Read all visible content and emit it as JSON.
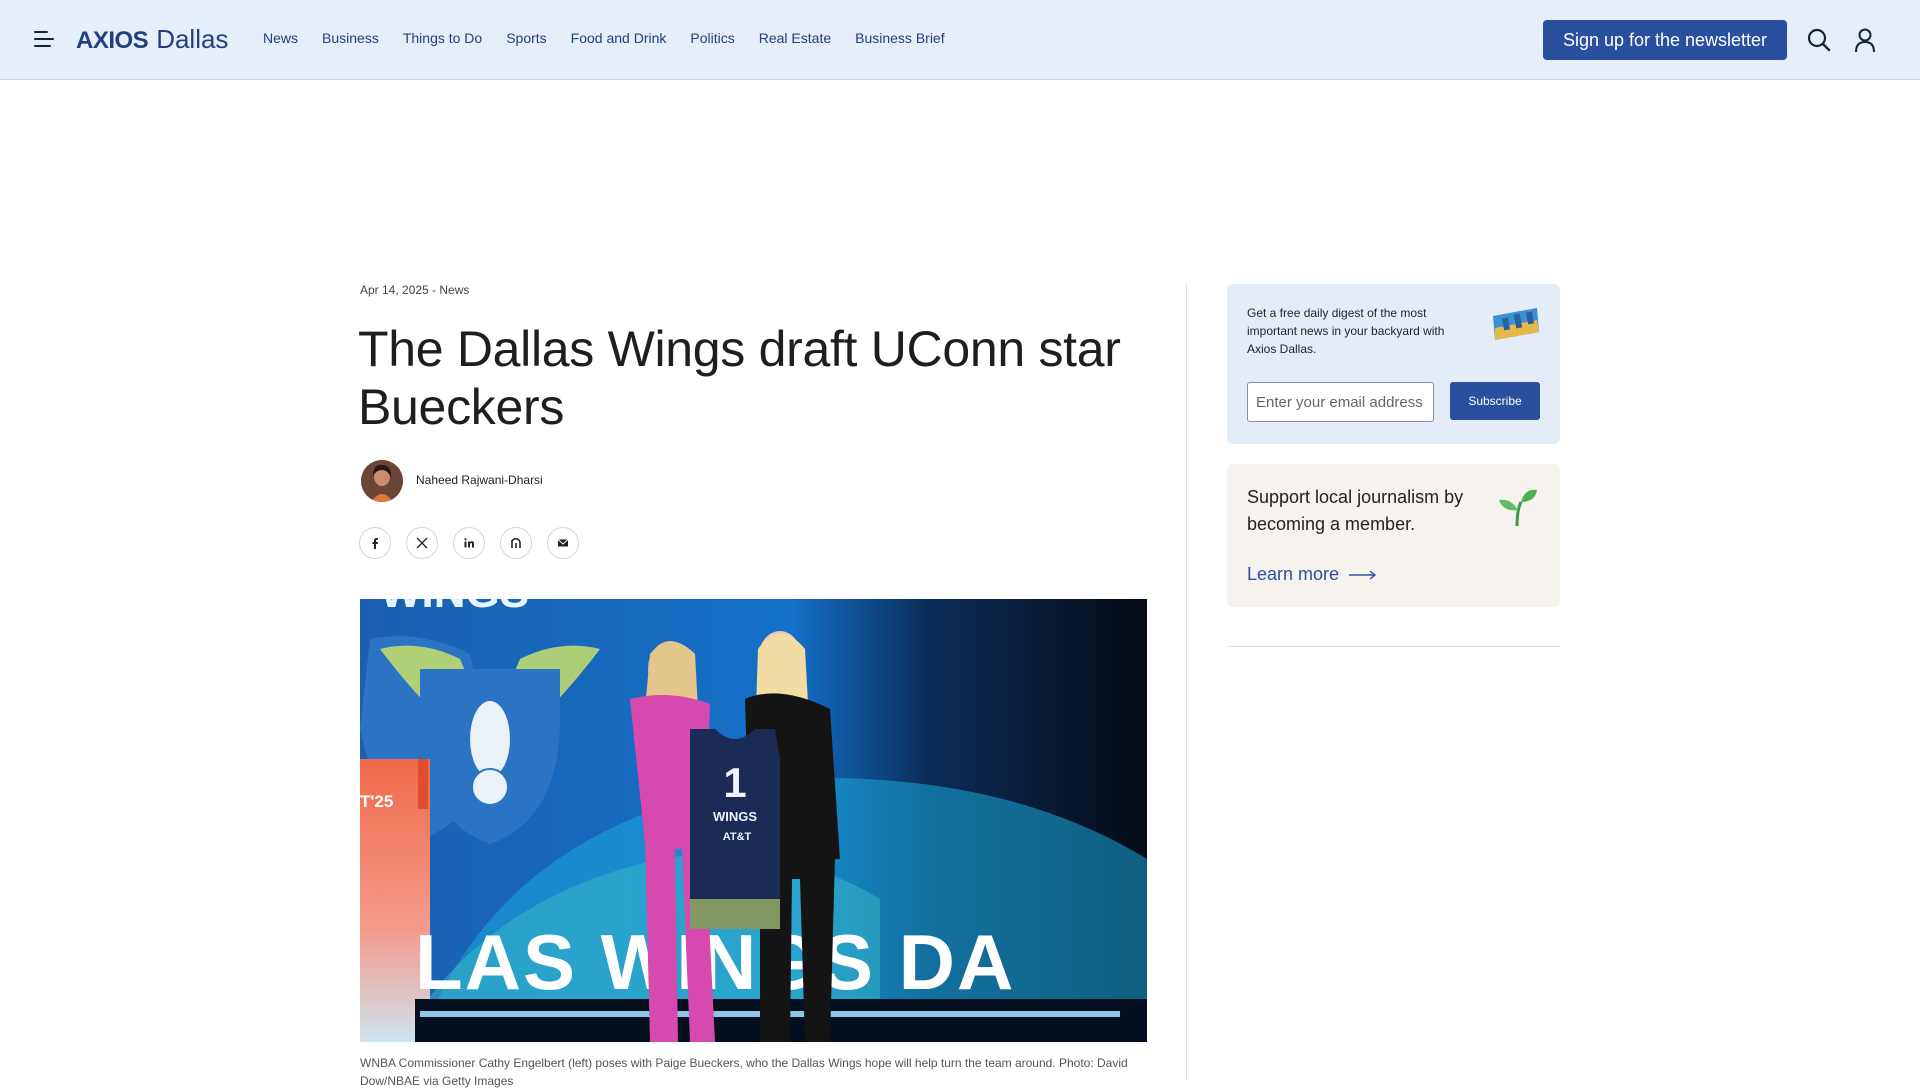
{
  "header": {
    "logo_brand": "AXIOS",
    "logo_city": "Dallas",
    "nav": [
      "News",
      "Business",
      "Things to Do",
      "Sports",
      "Food and Drink",
      "Politics",
      "Real Estate",
      "Business Brief"
    ],
    "signup_label": "Sign up for the newsletter",
    "icons": [
      "menu-icon",
      "search-icon",
      "user-icon"
    ]
  },
  "article": {
    "meta": "Apr 14, 2025 - News",
    "title": "The Dallas Wings draft UConn star Bueckers",
    "author": "Naheed Rajwani-Dharsi",
    "share_icons": [
      "facebook-icon",
      "x-icon",
      "linkedin-icon",
      "threads-icon",
      "email-icon"
    ],
    "photo": {
      "jersey_number": "1",
      "jersey_team": "WINGS",
      "jersey_sponsor": "AT&T",
      "stage_text": "LAS WINGS DA",
      "top_text": "WINGS",
      "side_text": "T'25"
    },
    "caption": "WNBA Commissioner Cathy Engelbert (left) poses with Paige Bueckers, who the Dallas Wings hope will help turn the team around. Photo: David Dow/NBAE via Getty Images"
  },
  "sidebar": {
    "newsletter": {
      "text": "Get a free daily digest of the most important news in your backyard with Axios Dallas.",
      "placeholder": "Enter your email address",
      "button": "Subscribe"
    },
    "membership": {
      "text": "Support local journalism by becoming a member.",
      "link": "Learn more"
    }
  },
  "colors": {
    "header_bg": "#e6eef9",
    "brand_blue": "#2a4f9f",
    "nav_text": "#23407e",
    "newsletter_bg": "#e4ecf8",
    "membership_bg": "#f6f3ef"
  }
}
